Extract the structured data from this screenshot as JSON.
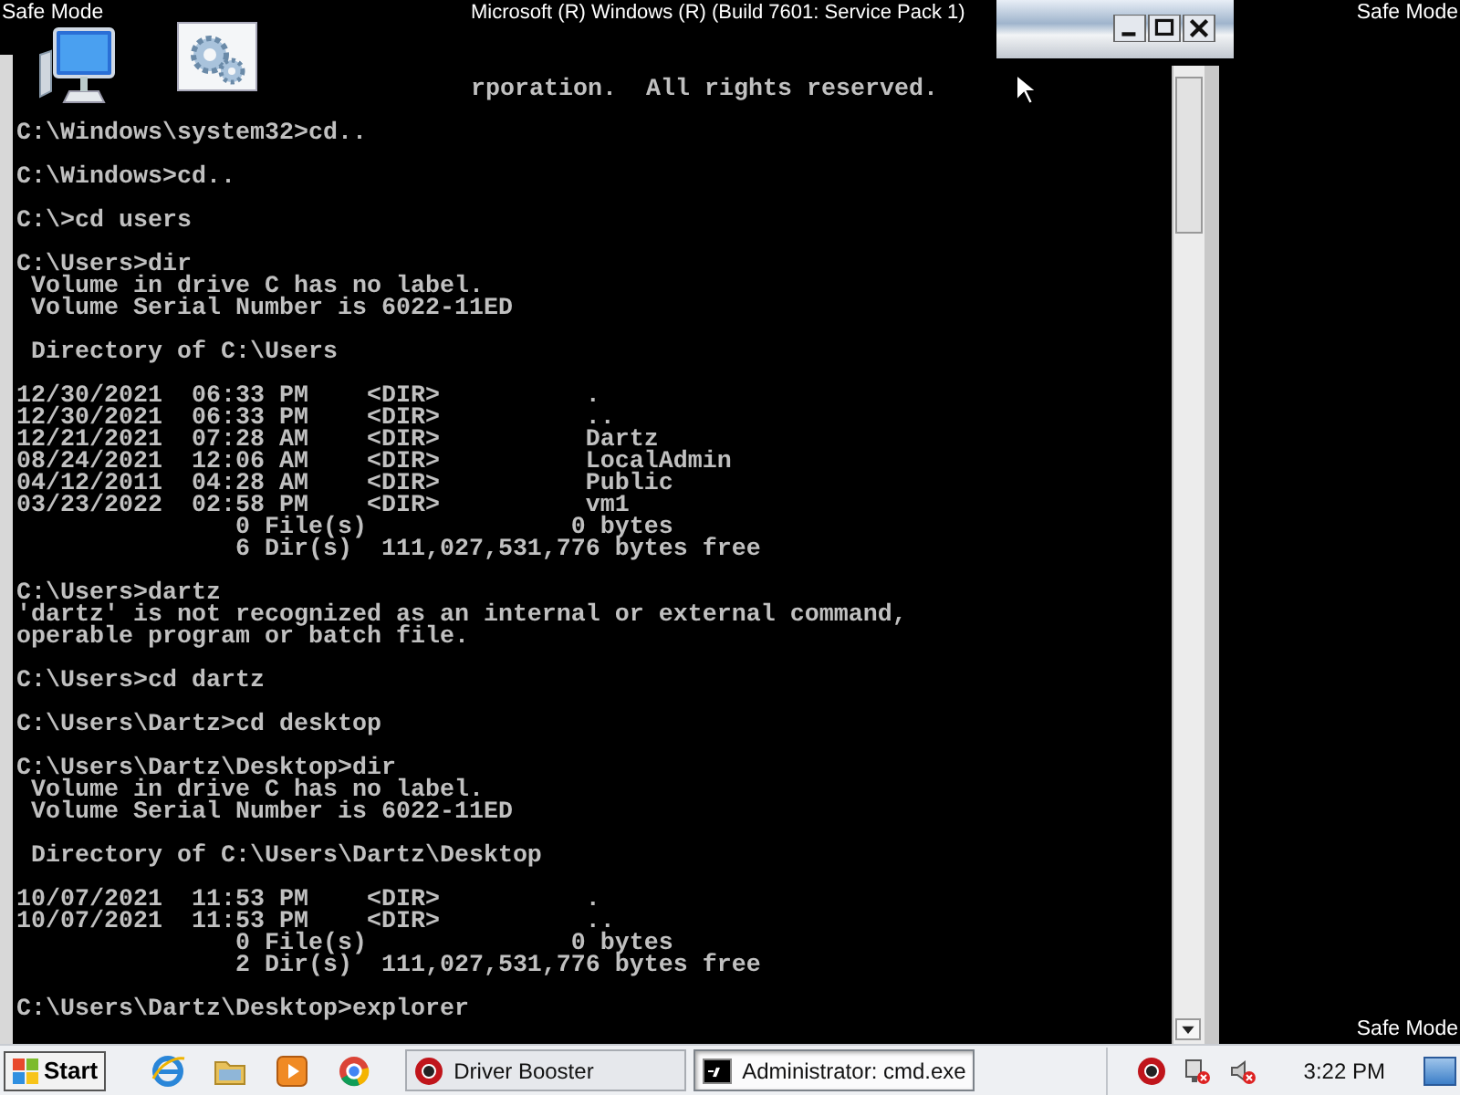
{
  "desktop": {
    "top_left_label": "Safe Mode",
    "build_label": "Microsoft (R) Windows (R) (Build 7601: Service Pack 1)",
    "top_right_label": "Safe Mode",
    "bottom_right_label": "Safe Mode"
  },
  "console": {
    "first_line": "rporation.  All rights reserved.",
    "blocks": [
      [
        "C:\\Windows\\system32>cd.."
      ],
      [
        "C:\\Windows>cd.."
      ],
      [
        "C:\\>cd users"
      ],
      [
        "C:\\Users>dir",
        " Volume in drive C has no label.",
        " Volume Serial Number is 6022-11ED"
      ],
      [
        " Directory of C:\\Users"
      ],
      [
        "12/30/2021  06:33 PM    <DIR>          .",
        "12/30/2021  06:33 PM    <DIR>          ..",
        "12/21/2021  07:28 AM    <DIR>          Dartz",
        "08/24/2021  12:06 AM    <DIR>          LocalAdmin",
        "04/12/2011  04:28 AM    <DIR>          Public",
        "03/23/2022  02:58 PM    <DIR>          vm1",
        "               0 File(s)              0 bytes",
        "               6 Dir(s)  111,027,531,776 bytes free"
      ],
      [
        "C:\\Users>dartz",
        "'dartz' is not recognized as an internal or external command,",
        "operable program or batch file."
      ],
      [
        "C:\\Users>cd dartz"
      ],
      [
        "C:\\Users\\Dartz>cd desktop"
      ],
      [
        "C:\\Users\\Dartz\\Desktop>dir",
        " Volume in drive C has no label.",
        " Volume Serial Number is 6022-11ED"
      ],
      [
        " Directory of C:\\Users\\Dartz\\Desktop"
      ],
      [
        "10/07/2021  11:53 PM    <DIR>          .",
        "10/07/2021  11:53 PM    <DIR>          ..",
        "               0 File(s)              0 bytes",
        "               2 Dir(s)  111,027,531,776 bytes free"
      ],
      [
        "C:\\Users\\Dartz\\Desktop>explorer"
      ]
    ]
  },
  "taskbar": {
    "start": "Start",
    "tasks": [
      {
        "kind": "booster",
        "label": "Driver Booster",
        "selected": false
      },
      {
        "kind": "console",
        "label": "Administrator: cmd.exe",
        "selected": true
      }
    ],
    "clock": "3:22 PM"
  }
}
